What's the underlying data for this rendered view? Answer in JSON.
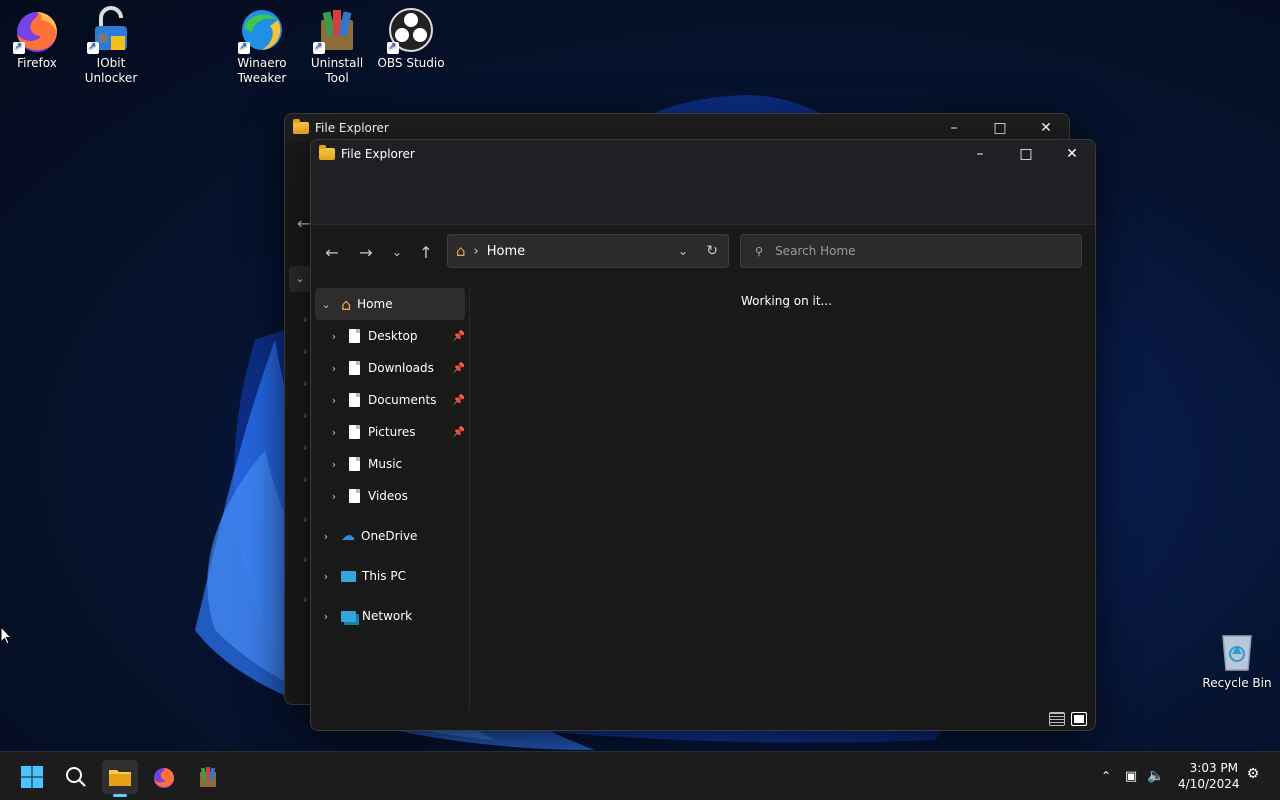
{
  "desktop": {
    "icons": [
      {
        "label": "Firefox"
      },
      {
        "label": "IObit Unlocker"
      },
      {
        "label": "Winaero Tweaker"
      },
      {
        "label": "Uninstall Tool"
      },
      {
        "label": "OBS Studio"
      },
      {
        "label": "Recycle Bin"
      }
    ]
  },
  "back_window": {
    "title": "File Explorer"
  },
  "window": {
    "title": "File Explorer",
    "address": {
      "location": "Home"
    },
    "search": {
      "placeholder": "Search Home"
    },
    "status": "Working on it...",
    "sidebar": {
      "home": "Home",
      "quick_access": [
        {
          "label": "Desktop",
          "pinned": true
        },
        {
          "label": "Downloads",
          "pinned": true
        },
        {
          "label": "Documents",
          "pinned": true
        },
        {
          "label": "Pictures",
          "pinned": true
        },
        {
          "label": "Music",
          "pinned": false
        },
        {
          "label": "Videos",
          "pinned": false
        }
      ],
      "onedrive": "OneDrive",
      "thispc": "This PC",
      "network": "Network"
    }
  },
  "taskbar": {
    "clock": {
      "time": "3:03 PM",
      "date": "4/10/2024"
    }
  },
  "colors": {
    "accent": "#60cdff",
    "window_bg": "#191919",
    "taskbar_bg": "#1c1c1c"
  }
}
